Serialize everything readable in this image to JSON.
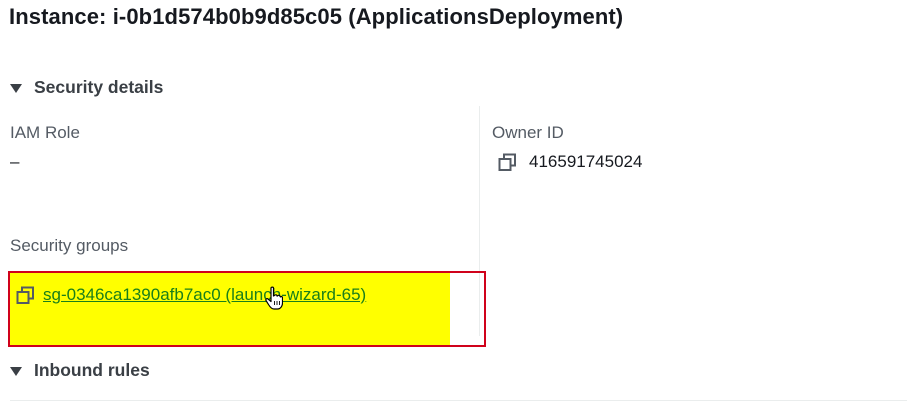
{
  "page": {
    "title": "Instance: i-0b1d574b0b9d85c05 (ApplicationsDeployment)"
  },
  "security_details": {
    "header": "Security details",
    "iam_role": {
      "label": "IAM Role",
      "value": "–"
    },
    "owner_id": {
      "label": "Owner ID",
      "value": "416591745024"
    },
    "security_groups": {
      "label": "Security groups",
      "link_text": "sg-0346ca1390afb7ac0 (launch-wizard-65)"
    }
  },
  "inbound_rules": {
    "header": "Inbound rules"
  },
  "icons": {
    "copy": "copy-icon",
    "caret": "caret-down-icon",
    "cursor": "hand-pointer-cursor-icon"
  },
  "colors": {
    "link": "#1a7f1a",
    "highlight": "#ffff00",
    "annotation_border": "#d0021b"
  }
}
